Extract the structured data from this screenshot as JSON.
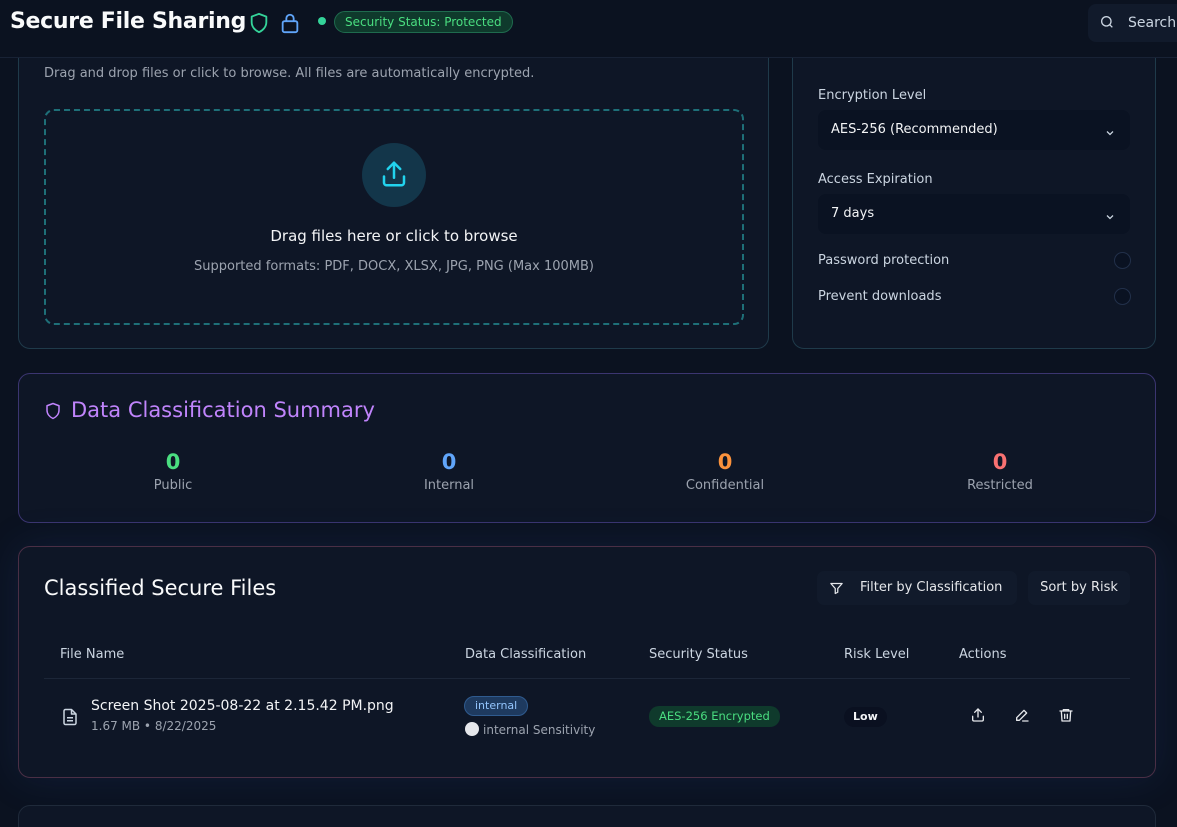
{
  "header": {
    "title": "Secure File Sharing",
    "status_badge": "Security Status: Protected",
    "search_label": "Search"
  },
  "upload": {
    "description": "Drag and drop files or click to browse. All files are automatically encrypted.",
    "drop_title": "Drag files here or click to browse",
    "drop_subtitle": "Supported formats: PDF, DOCX, XLSX, JPG, PNG (Max 100MB)"
  },
  "settings": {
    "encryption_label": "Encryption Level",
    "encryption_value": "AES-256 (Recommended)",
    "expiration_label": "Access Expiration",
    "expiration_value": "7 days",
    "password_label": "Password protection",
    "downloads_label": "Prevent downloads"
  },
  "classification": {
    "title": "Data Classification Summary",
    "stats": [
      {
        "count": "0",
        "label": "Public",
        "color": "#4ade80"
      },
      {
        "count": "0",
        "label": "Internal",
        "color": "#60a5fa"
      },
      {
        "count": "0",
        "label": "Confidential",
        "color": "#fb923c"
      },
      {
        "count": "0",
        "label": "Restricted",
        "color": "#f87171"
      }
    ]
  },
  "files": {
    "title": "Classified Secure Files",
    "filter_label": "Filter by Classification",
    "sort_label": "Sort by Risk",
    "columns": [
      "File Name",
      "Data Classification",
      "Security Status",
      "Risk Level",
      "Actions"
    ],
    "rows": [
      {
        "name": "Screen Shot 2025-08-22 at 2.15.42 PM.png",
        "meta": "1.67 MB • 8/22/2025",
        "classification": "internal",
        "sensitivity": "internal Sensitivity",
        "security_status": "AES-256 Encrypted",
        "risk": "Low"
      }
    ]
  },
  "colors": {
    "accent": "#22d3ee",
    "success": "#4ade80",
    "purple": "#c084fc"
  }
}
